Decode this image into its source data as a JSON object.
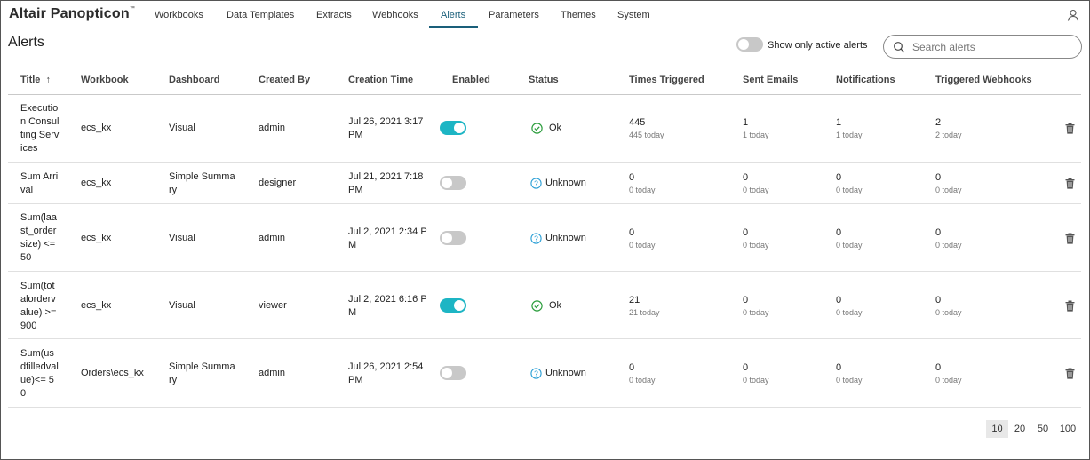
{
  "app": {
    "logo_text": "Altair Panopticon",
    "logo_mark": "™"
  },
  "nav": {
    "tabs": [
      "Workbooks",
      "Data Templates",
      "Extracts",
      "Webhooks",
      "Alerts",
      "Parameters",
      "Themes",
      "System"
    ],
    "active": "Alerts"
  },
  "page": {
    "title": "Alerts",
    "active_toggle_label": "Show only active alerts",
    "active_toggle_on": false,
    "search_placeholder": "Search alerts",
    "search_value": ""
  },
  "table": {
    "sort_indicator": "↑",
    "columns": [
      "Title",
      "Workbook",
      "Dashboard",
      "Created By",
      "Creation Time",
      "Enabled",
      "Status",
      "Times Triggered",
      "Sent Emails",
      "Notifications",
      "Triggered Webhooks"
    ],
    "rows": [
      {
        "title": "Execution Consulting Services",
        "workbook": "ecs_kx",
        "dashboard": "Visual",
        "created_by": "admin",
        "creation_time": "Jul 26, 2021 3:17 PM",
        "enabled": true,
        "status": "Ok",
        "times_triggered": "445",
        "times_triggered_today": "445 today",
        "sent_emails": "1",
        "sent_emails_today": "1 today",
        "notifications": "1",
        "notifications_today": "1 today",
        "webhooks": "2",
        "webhooks_today": "2 today"
      },
      {
        "title": "Sum Arrival",
        "workbook": "ecs_kx",
        "dashboard": "Simple Summary",
        "created_by": "designer",
        "creation_time": "Jul 21, 2021 7:18 PM",
        "enabled": false,
        "status": "Unknown",
        "times_triggered": "0",
        "times_triggered_today": "0 today",
        "sent_emails": "0",
        "sent_emails_today": "0 today",
        "notifications": "0",
        "notifications_today": "0 today",
        "webhooks": "0",
        "webhooks_today": "0 today"
      },
      {
        "title": "Sum(laast_ordersize) <= 50",
        "workbook": "ecs_kx",
        "dashboard": "Visual",
        "created_by": "admin",
        "creation_time": "Jul 2, 2021 2:34 PM",
        "enabled": false,
        "status": "Unknown",
        "times_triggered": "0",
        "times_triggered_today": "0 today",
        "sent_emails": "0",
        "sent_emails_today": "0 today",
        "notifications": "0",
        "notifications_today": "0 today",
        "webhooks": "0",
        "webhooks_today": "0 today"
      },
      {
        "title": "Sum(totalordervalue) >= 900",
        "workbook": "ecs_kx",
        "dashboard": "Visual",
        "created_by": "viewer",
        "creation_time": "Jul 2, 2021 6:16 PM",
        "enabled": true,
        "status": "Ok",
        "times_triggered": "21",
        "times_triggered_today": "21 today",
        "sent_emails": "0",
        "sent_emails_today": "0 today",
        "notifications": "0",
        "notifications_today": "0 today",
        "webhooks": "0",
        "webhooks_today": "0 today"
      },
      {
        "title": "Sum(usdfilledvalue)<= 50",
        "workbook": "Orders\\ecs_kx",
        "dashboard": "Simple Summary",
        "created_by": "admin",
        "creation_time": "Jul 26, 2021 2:54 PM",
        "enabled": false,
        "status": "Unknown",
        "times_triggered": "0",
        "times_triggered_today": "0 today",
        "sent_emails": "0",
        "sent_emails_today": "0 today",
        "notifications": "0",
        "notifications_today": "0 today",
        "webhooks": "0",
        "webhooks_today": "0 today"
      }
    ]
  },
  "pagination": {
    "sizes": [
      "10",
      "20",
      "50",
      "100"
    ],
    "selected": "10"
  },
  "colors": {
    "accent": "#1a5f7a",
    "toggle_on": "#1db5c4",
    "ok_green": "#2e9e3f",
    "unknown_blue": "#2a9fd6"
  },
  "icons": {
    "user": "user-icon",
    "search": "search-icon",
    "ok": "check-circle-icon",
    "unknown": "question-circle-icon",
    "delete": "trash-icon"
  }
}
